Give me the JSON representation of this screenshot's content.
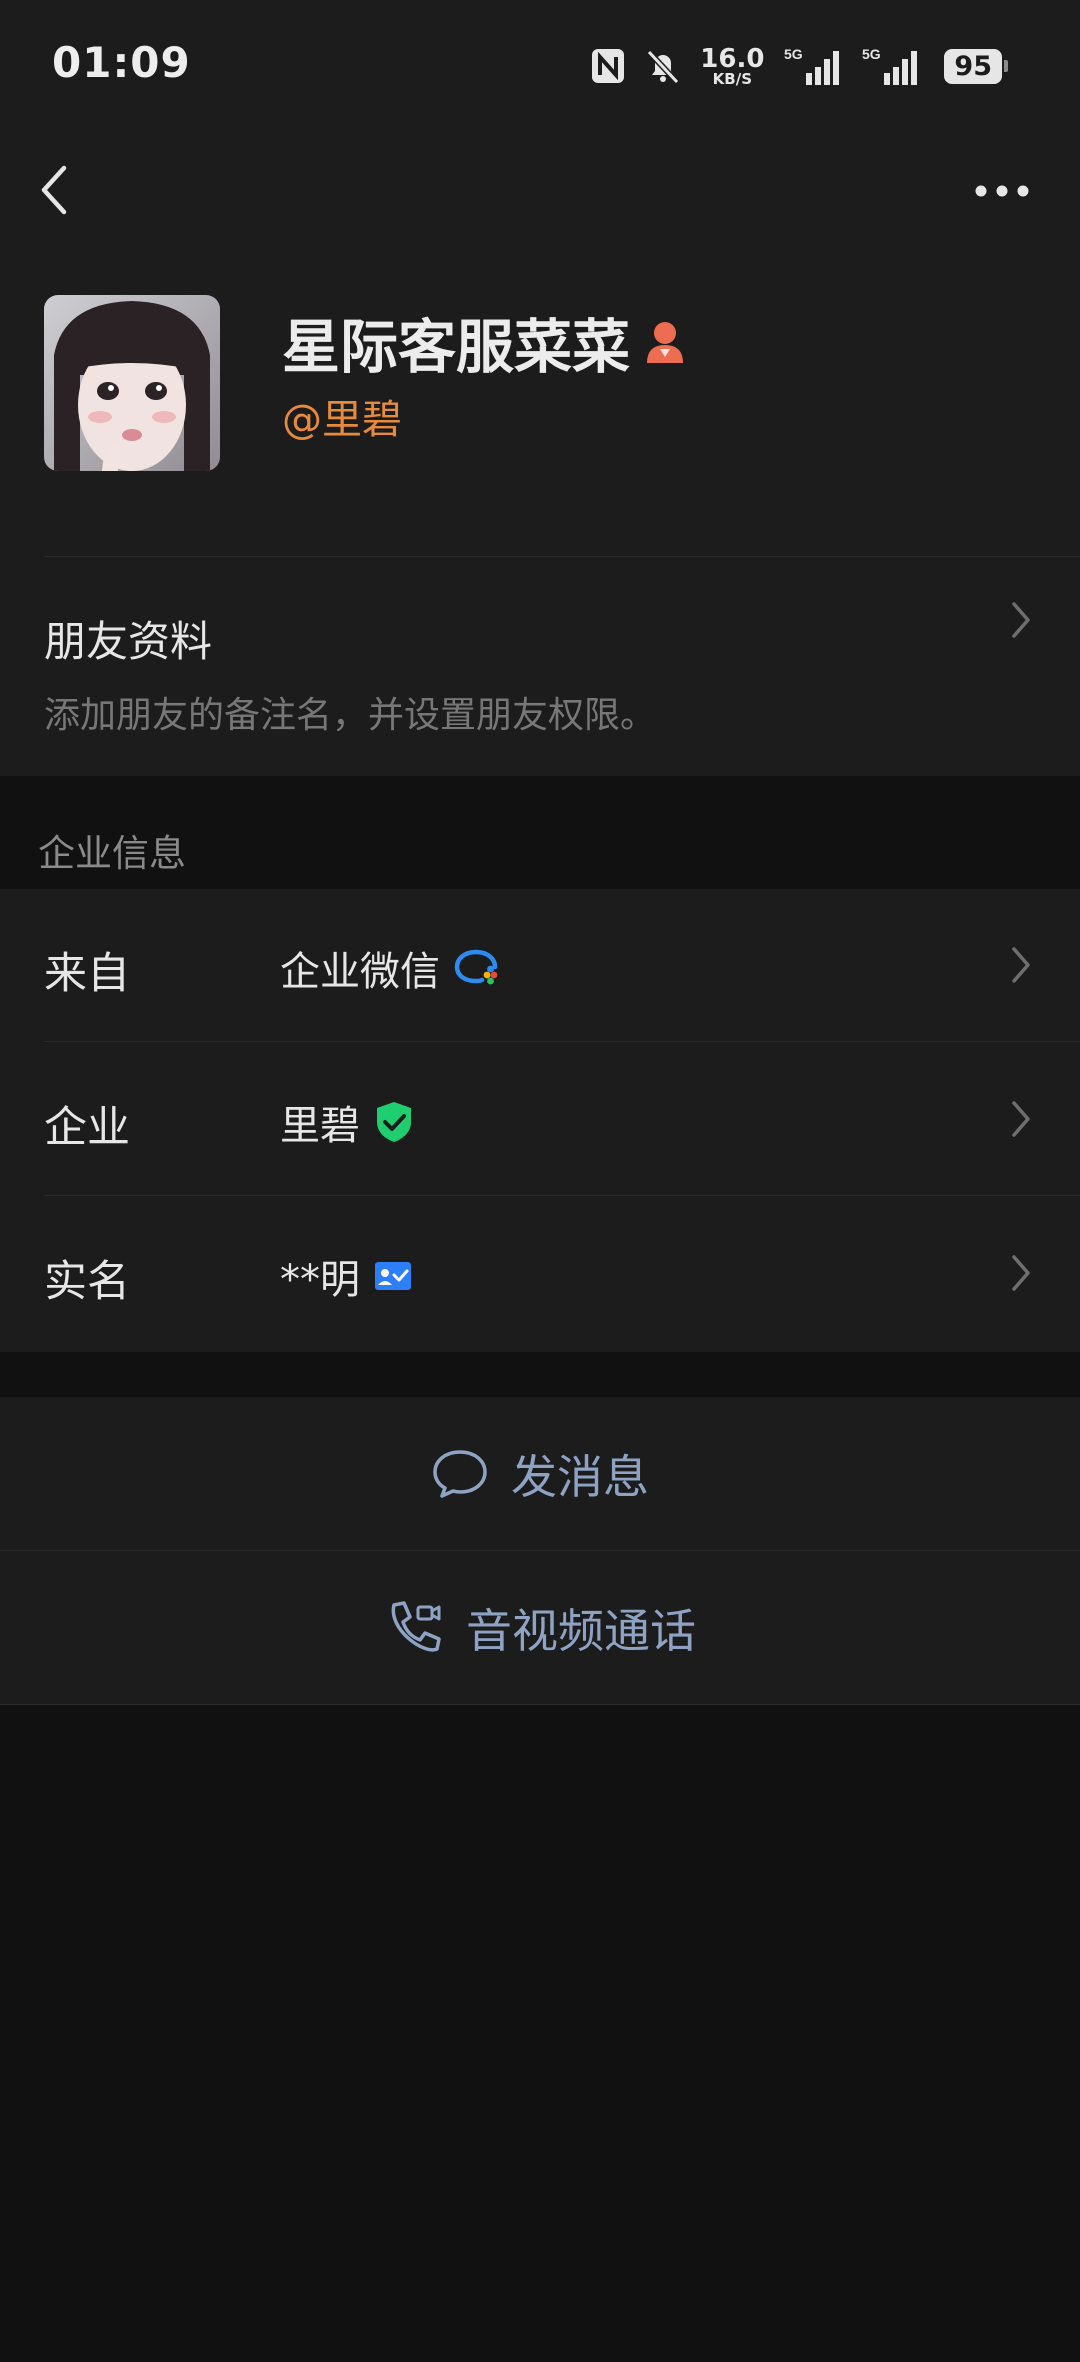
{
  "status_bar": {
    "time": "01:09",
    "net_speed": "16.0",
    "net_speed_unit": "KB/S",
    "signal_1_label": "5G",
    "signal_2_label": "5G",
    "battery": "95"
  },
  "profile": {
    "name": "星际客服菜菜",
    "handle": "@里碧"
  },
  "friend_info": {
    "title": "朋友资料",
    "description": "添加朋友的备注名，并设置朋友权限。"
  },
  "enterprise": {
    "section_label": "企业信息",
    "rows": [
      {
        "label": "来自",
        "value": "企业微信"
      },
      {
        "label": "企业",
        "value": "里碧"
      },
      {
        "label": "实名",
        "value": "**明"
      }
    ]
  },
  "actions": {
    "send_message": "发消息",
    "av_call": "音视频通话"
  },
  "colors": {
    "background": "#111111",
    "card": "#1c1c1c",
    "handle": "#e68a3c",
    "action_text": "#8ea3c4",
    "verified": "#1fce6f",
    "idcard": "#2d7ff9",
    "gender": "#ec6d52"
  }
}
